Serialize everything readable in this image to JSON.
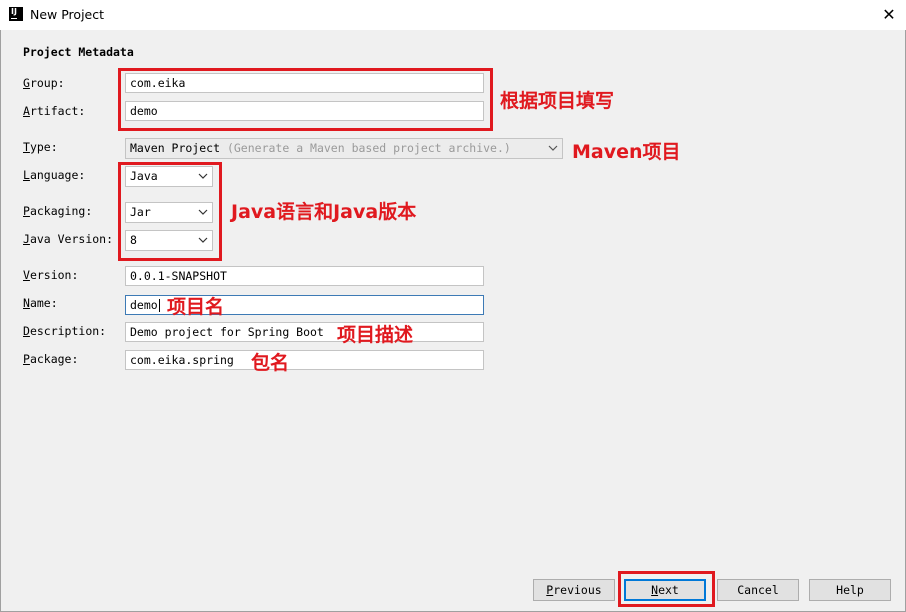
{
  "window": {
    "title": "New Project",
    "app_icon_text": "IJ",
    "close_glyph": "✕"
  },
  "section_title": "Project Metadata",
  "labels": {
    "group": [
      "G",
      "roup:"
    ],
    "artifact": [
      "A",
      "rtifact:"
    ],
    "type": [
      "T",
      "ype:"
    ],
    "language": [
      "L",
      "anguage:"
    ],
    "packaging": [
      "P",
      "ackaging:"
    ],
    "java_version": [
      "J",
      "ava Version:"
    ],
    "version": [
      "V",
      "ersion:"
    ],
    "name": [
      "N",
      "ame:"
    ],
    "description": [
      "D",
      "escription:"
    ],
    "package": [
      "P",
      "ackage:"
    ]
  },
  "fields": {
    "group": "com.eika",
    "artifact": "demo",
    "version": "0.0.1-SNAPSHOT",
    "name": "demo",
    "description": "Demo project for Spring Boot",
    "package": "com.eika.spring"
  },
  "selects": {
    "type": {
      "value": "Maven Project",
      "hint": "(Generate a Maven based project archive.)"
    },
    "language": "Java",
    "packaging": "Jar",
    "java_version": "8"
  },
  "annotations": {
    "group_artifact": "根据项目填写",
    "type": "Maven项目",
    "language_java": "Java语言和Java版本",
    "name": "项目名",
    "description": "项目描述",
    "package": "包名"
  },
  "buttons": {
    "previous": [
      "P",
      "revious"
    ],
    "next": [
      "N",
      "ext"
    ],
    "cancel": "Cancel",
    "help": "Help"
  },
  "colors": {
    "annotation_red": "#e0191f",
    "focus_blue": "#3d7ab5",
    "default_button_blue": "#0078d7"
  }
}
